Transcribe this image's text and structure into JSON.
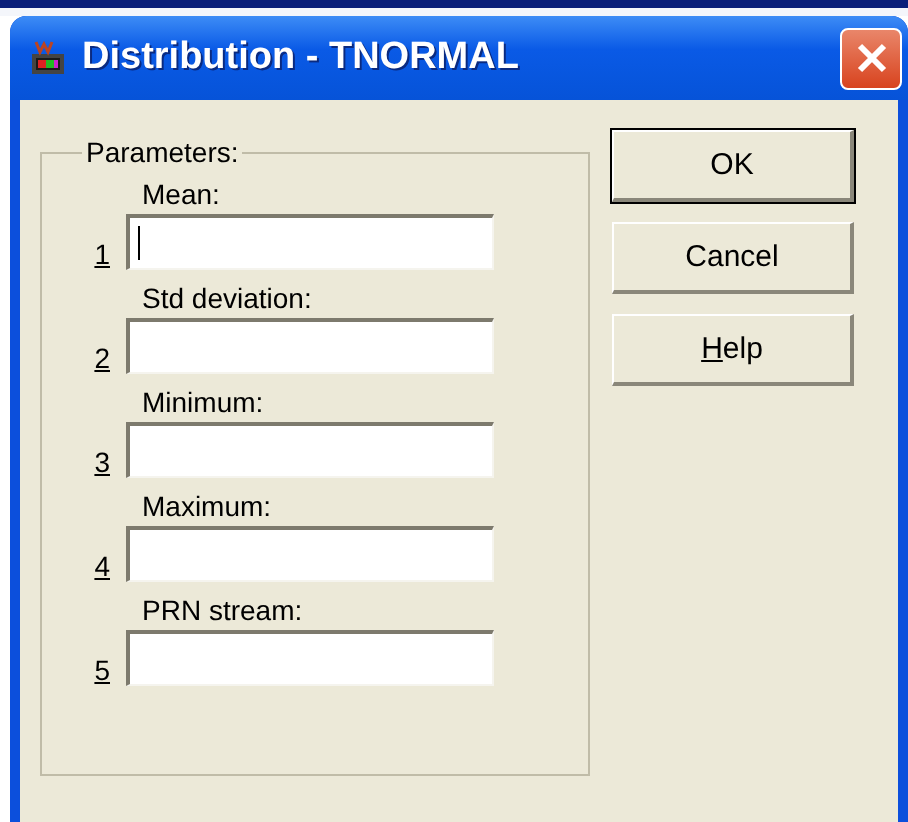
{
  "window": {
    "title": "Distribution - TNORMAL"
  },
  "parameters": {
    "title": "Parameters:",
    "fields": [
      {
        "number": "1",
        "label": "Mean:",
        "focused": true
      },
      {
        "number": "2",
        "label": "Std deviation:",
        "focused": false
      },
      {
        "number": "3",
        "label": "Minimum:",
        "focused": false
      },
      {
        "number": "4",
        "label": "Maximum:",
        "focused": false
      },
      {
        "number": "5",
        "label": "PRN stream:",
        "focused": false
      }
    ]
  },
  "buttons": [
    {
      "label": "OK",
      "default": true,
      "mnemonic_underlined": false
    },
    {
      "label": "Cancel",
      "default": false,
      "mnemonic_underlined": false
    },
    {
      "label": "Help",
      "default": false,
      "mnemonic_underlined": true
    }
  ]
}
